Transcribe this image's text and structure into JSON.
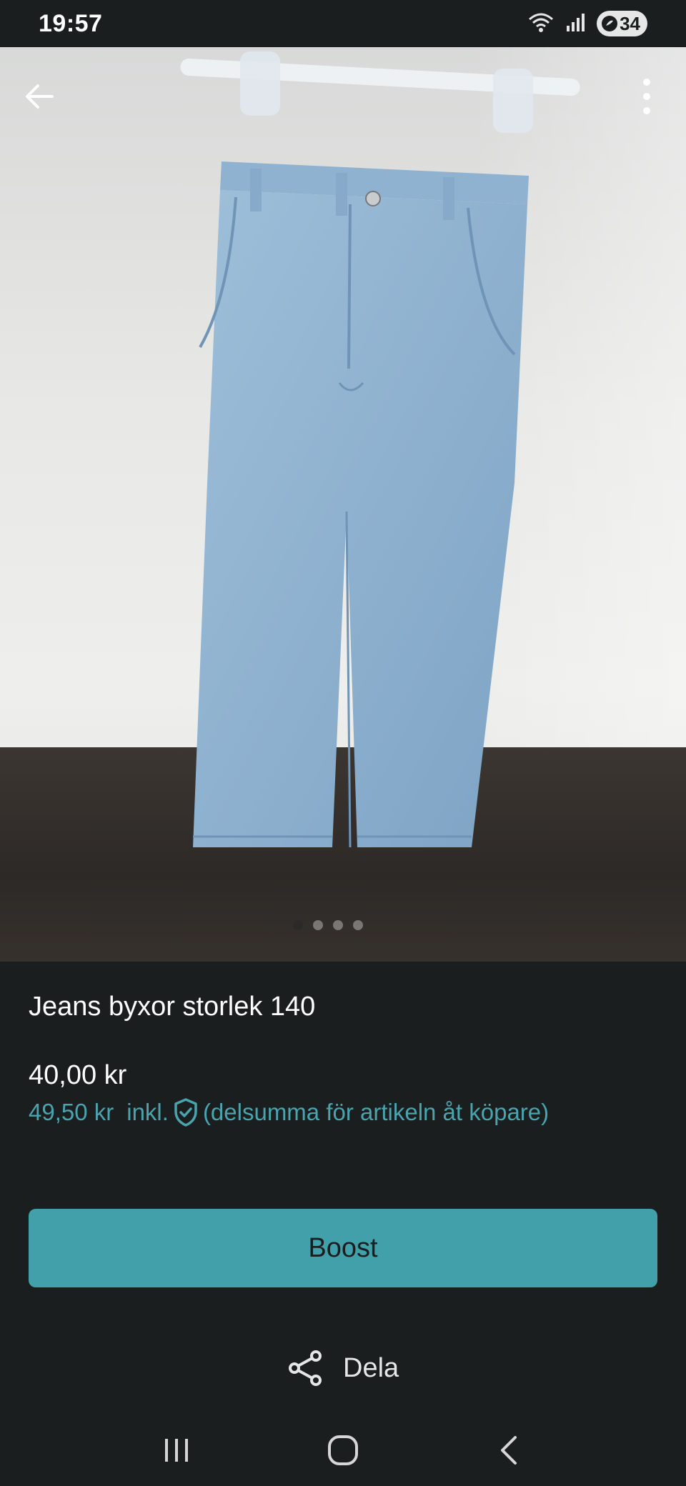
{
  "status_bar": {
    "time": "19:57",
    "battery": "34",
    "icons": [
      "wifi-icon",
      "signal-icon",
      "battery-icon"
    ]
  },
  "header": {
    "back_icon": "arrow-left-icon",
    "menu_icon": "more-vertical-icon"
  },
  "listing": {
    "title": "Jeans byxor storlek 140",
    "price": "40,00 kr",
    "subtotal_price": "49,50 kr",
    "subtotal_incl": "inkl.",
    "subtotal_note": "(delsumma för artikeln åt köpare)",
    "image_count": 4,
    "active_image": 1
  },
  "actions": {
    "boost_label": "Boost",
    "share_label": "Dela"
  },
  "colors": {
    "background": "#1a1e1f",
    "accent": "#42a0ab",
    "accent_text": "#4aa3ad"
  },
  "nav": {
    "icons": [
      "recent-apps-icon",
      "home-icon",
      "back-icon"
    ]
  }
}
